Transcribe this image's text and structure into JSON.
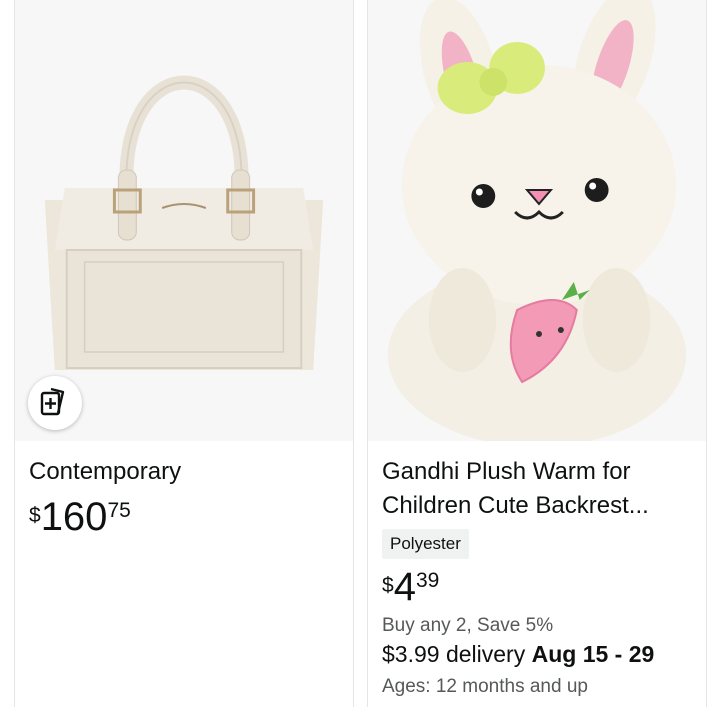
{
  "products": [
    {
      "title": "Contemporary",
      "price": {
        "symbol": "$",
        "whole": "160",
        "fraction": "75"
      },
      "icon": "compare-cards-icon"
    },
    {
      "title": "Gandhi Plush Warm for Children Cute Backrest...",
      "badge": "Polyester",
      "price": {
        "symbol": "$",
        "whole": "4",
        "fraction": "39"
      },
      "promo": "Buy any 2, Save 5%",
      "delivery_prefix": "$3.99 delivery ",
      "delivery_dates": "Aug 15 - 29",
      "ages": "Ages: 12 months and up"
    }
  ],
  "colors": {
    "text": "#0f1111",
    "muted": "#565959",
    "badge_bg": "#f0f2f2",
    "image_bg": "#f7f7f7"
  }
}
